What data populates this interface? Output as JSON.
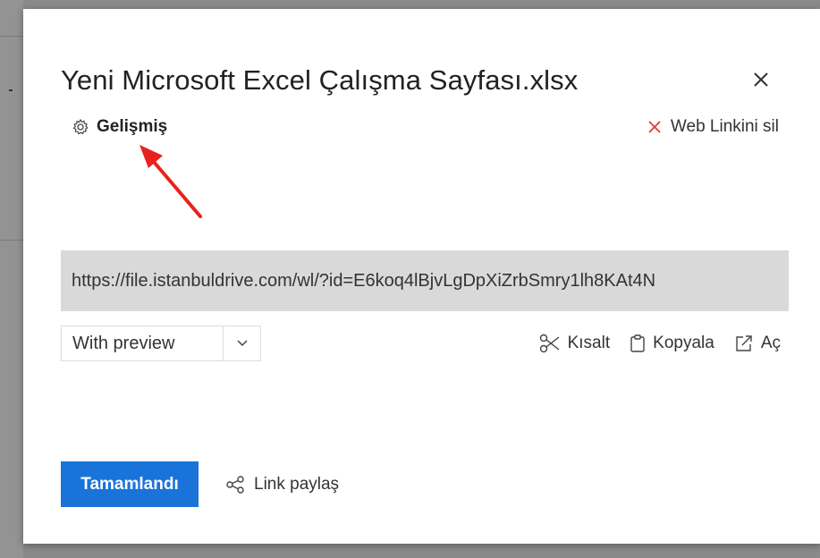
{
  "dialog": {
    "title": "Yeni Microsoft Excel Çalışma Sayfası.xlsx",
    "advanced_label": "Gelişmiş",
    "remove_link_label": "Web Linkini sil",
    "url": "https://file.istanbuldrive.com/wl/?id=E6koq4lBjvLgDpXiZrbSmry1lh8KAt4N",
    "link_mode": {
      "selected": "With preview"
    },
    "actions": {
      "shorten_label": "Kısalt",
      "copy_label": "Kopyala",
      "open_label": "Aç"
    },
    "done_label": "Tamamlandı",
    "share_label": "Link paylaş"
  },
  "icons": {
    "close": "close-icon",
    "advanced": "gear-icon",
    "remove": "x-icon",
    "shorten": "scissors-icon",
    "copy": "clipboard-icon",
    "open": "external-link-icon",
    "share": "share-icon",
    "dropdown": "chevron-down-icon"
  },
  "colors": {
    "primary": "#1a73d9",
    "remove_accent": "#e53935",
    "annotation_arrow": "#e8221c",
    "url_background": "#d9d9d9"
  }
}
